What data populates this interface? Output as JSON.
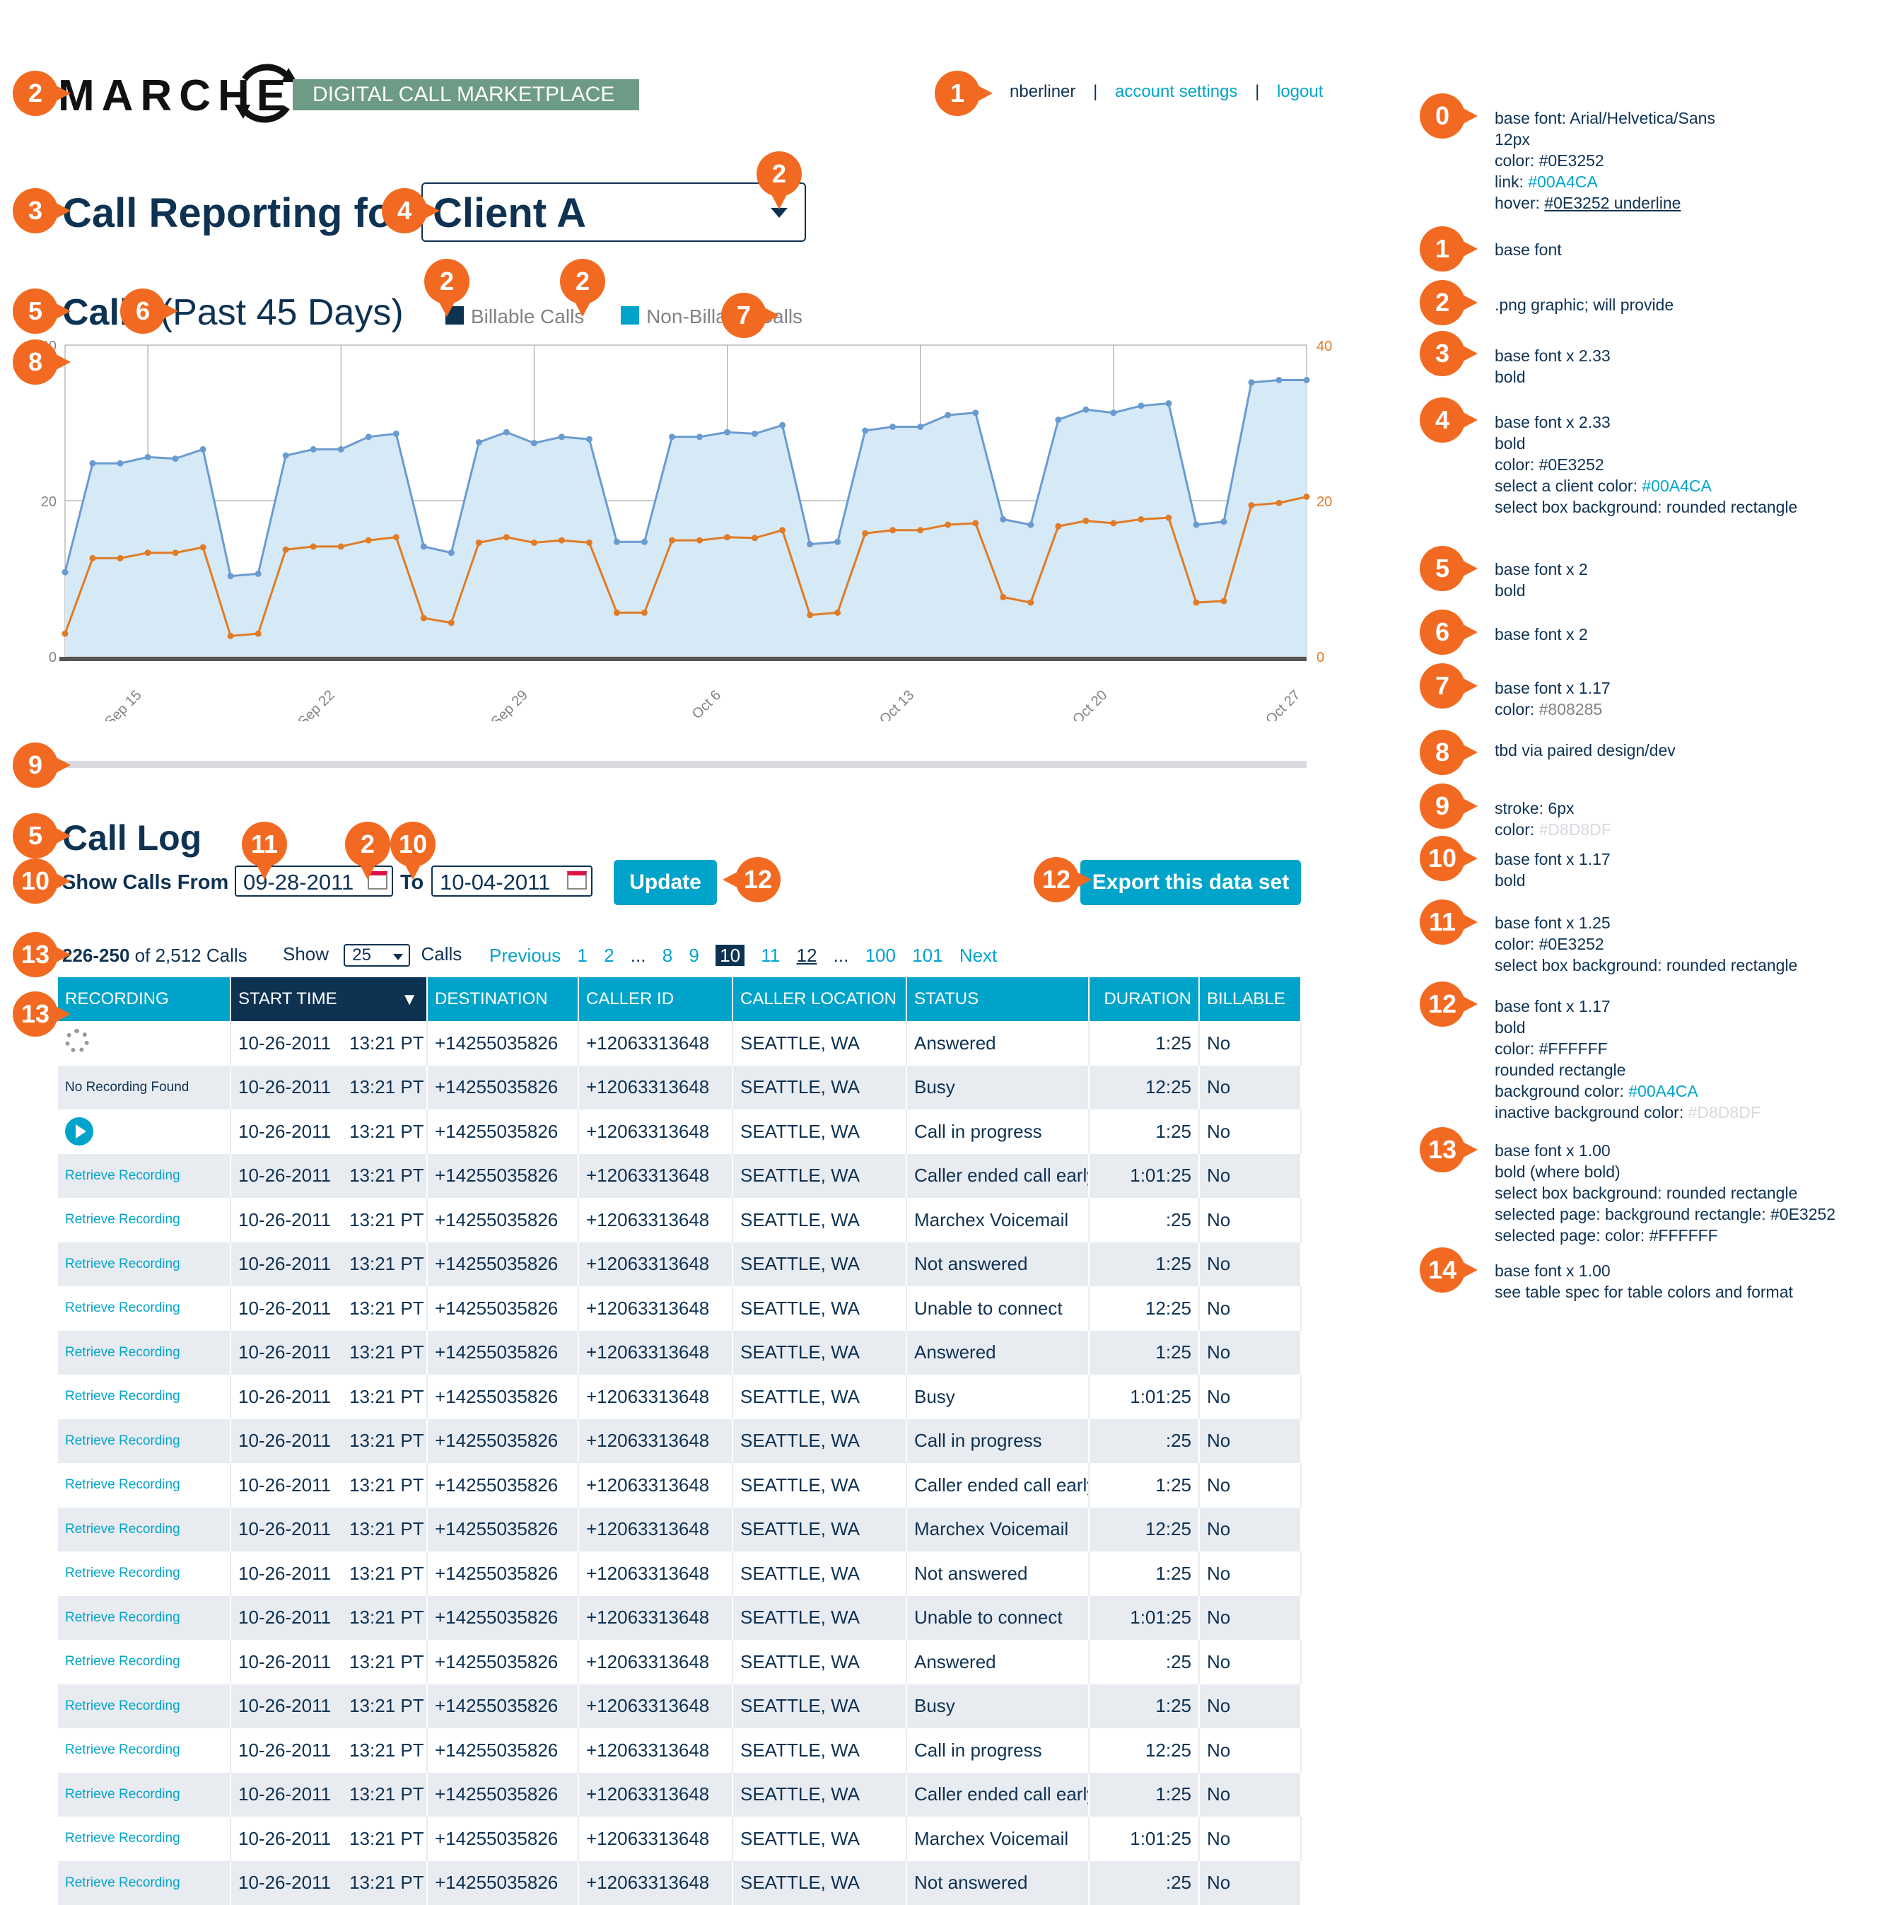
{
  "header": {
    "logo_text": "MARCHEX",
    "tagline": "DIGITAL CALL MARKETPLACE",
    "username": "nberliner",
    "separator": "|",
    "account_settings": "account settings",
    "logout": "logout"
  },
  "title": {
    "prefix": "Call Reporting for",
    "client": "Client A"
  },
  "calls_section": {
    "title_bold": "Calls",
    "title_light": "(Past 45 Days)",
    "legend_billable": "Billable Calls",
    "legend_nonbillable": "Non-Billable Calls"
  },
  "chart_data": {
    "type": "area",
    "title": "Calls (Past 45 Days)",
    "x_tick_labels": [
      "Sep 15",
      "Sep 22",
      "Sep 29",
      "Oct 6",
      "Oct 13",
      "Oct 20",
      "Oct 27"
    ],
    "y_left_ticks": [
      "0",
      "20",
      "40"
    ],
    "y_right_ticks": [
      "0",
      "20",
      "40"
    ],
    "ylim": [
      0,
      40
    ],
    "grid": true,
    "series": [
      {
        "name": "Non-Billable Calls",
        "color": "#6A9BD0",
        "fill": "#D6E9F7",
        "values": [
          10.8,
          24.8,
          24.8,
          25.6,
          25.4,
          26.6,
          10.3,
          10.6,
          25.8,
          26.6,
          26.6,
          28.2,
          28.6,
          14.1,
          13.3,
          27.5,
          28.8,
          27.4,
          28.2,
          27.9,
          14.7,
          14.7,
          28.2,
          28.2,
          28.8,
          28.6,
          29.7,
          14.4,
          14.7,
          29.0,
          29.5,
          29.5,
          31.0,
          31.3,
          17.6,
          16.9,
          30.4,
          31.7,
          31.3,
          32.2,
          32.5,
          16.9,
          17.3,
          35.2,
          35.5,
          35.5
        ]
      },
      {
        "name": "Billable Calls",
        "color": "#E07B26",
        "values": [
          2.9,
          12.6,
          12.6,
          13.3,
          13.3,
          14.0,
          2.6,
          2.9,
          13.7,
          14.1,
          14.1,
          14.9,
          15.3,
          4.9,
          4.3,
          14.6,
          15.3,
          14.6,
          14.9,
          14.6,
          5.6,
          5.6,
          14.9,
          14.9,
          15.3,
          15.2,
          16.2,
          5.3,
          5.6,
          15.8,
          16.2,
          16.2,
          16.9,
          17.1,
          7.6,
          6.9,
          16.7,
          17.4,
          17.1,
          17.6,
          17.8,
          6.9,
          7.1,
          19.4,
          19.7,
          20.5
        ]
      }
    ]
  },
  "call_log": {
    "title": "Call Log",
    "show_from_label": "Show Calls From",
    "from_date": "09-28-2011",
    "to_label": "To",
    "to_date": "10-04-2011",
    "update_button": "Update",
    "export_button": "Export this data set",
    "range_bold": "226-250",
    "range_rest": "of 2,512 Calls",
    "show_label": "Show",
    "show_value": "25",
    "calls_label": "Calls",
    "pager": {
      "previous": "Previous",
      "p1": "1",
      "p2": "2",
      "dots1": "...",
      "p8": "8",
      "p9": "9",
      "p10": "10",
      "p11": "11",
      "p12": "12",
      "dots2": "...",
      "p100": "100",
      "p101": "101",
      "next": "Next"
    },
    "columns": [
      "RECORDING",
      "START TIME",
      "DESTINATION",
      "CALLER ID",
      "CALLER LOCATION",
      "STATUS",
      "DURATION",
      "BILLABLE"
    ],
    "sort_indicator": "▼",
    "rows": [
      {
        "rec_type": "spinner",
        "recording": "",
        "date": "10-26-2011",
        "time": "13:21 PT",
        "destination": "+14255035826",
        "caller_id": "+12063313648",
        "location": "SEATTLE, WA",
        "status": "Answered",
        "duration": "1:25",
        "billable": "No"
      },
      {
        "rec_type": "text",
        "recording": "No Recording Found",
        "date": "10-26-2011",
        "time": "13:21 PT",
        "destination": "+14255035826",
        "caller_id": "+12063313648",
        "location": "SEATTLE, WA",
        "status": "Busy",
        "duration": "12:25",
        "billable": "No"
      },
      {
        "rec_type": "play",
        "recording": "",
        "date": "10-26-2011",
        "time": "13:21 PT",
        "destination": "+14255035826",
        "caller_id": "+12063313648",
        "location": "SEATTLE, WA",
        "status": "Call in progress",
        "duration": "1:25",
        "billable": "No"
      },
      {
        "rec_type": "link",
        "recording": "Retrieve Recording",
        "date": "10-26-2011",
        "time": "13:21 PT",
        "destination": "+14255035826",
        "caller_id": "+12063313648",
        "location": "SEATTLE, WA",
        "status": "Caller ended call early",
        "duration": "1:01:25",
        "billable": "No"
      },
      {
        "rec_type": "link",
        "recording": "Retrieve Recording",
        "date": "10-26-2011",
        "time": "13:21 PT",
        "destination": "+14255035826",
        "caller_id": "+12063313648",
        "location": "SEATTLE, WA",
        "status": "Marchex Voicemail",
        "duration": ":25",
        "billable": "No"
      },
      {
        "rec_type": "link",
        "recording": "Retrieve Recording",
        "date": "10-26-2011",
        "time": "13:21 PT",
        "destination": "+14255035826",
        "caller_id": "+12063313648",
        "location": "SEATTLE, WA",
        "status": "Not answered",
        "duration": "1:25",
        "billable": "No"
      },
      {
        "rec_type": "link",
        "recording": "Retrieve Recording",
        "date": "10-26-2011",
        "time": "13:21 PT",
        "destination": "+14255035826",
        "caller_id": "+12063313648",
        "location": "SEATTLE, WA",
        "status": "Unable to connect",
        "duration": "12:25",
        "billable": "No"
      },
      {
        "rec_type": "link",
        "recording": "Retrieve Recording",
        "date": "10-26-2011",
        "time": "13:21 PT",
        "destination": "+14255035826",
        "caller_id": "+12063313648",
        "location": "SEATTLE, WA",
        "status": "Answered",
        "duration": "1:25",
        "billable": "No"
      },
      {
        "rec_type": "link",
        "recording": "Retrieve Recording",
        "date": "10-26-2011",
        "time": "13:21 PT",
        "destination": "+14255035826",
        "caller_id": "+12063313648",
        "location": "SEATTLE, WA",
        "status": "Busy",
        "duration": "1:01:25",
        "billable": "No"
      },
      {
        "rec_type": "link",
        "recording": "Retrieve Recording",
        "date": "10-26-2011",
        "time": "13:21 PT",
        "destination": "+14255035826",
        "caller_id": "+12063313648",
        "location": "SEATTLE, WA",
        "status": "Call in progress",
        "duration": ":25",
        "billable": "No"
      },
      {
        "rec_type": "link",
        "recording": "Retrieve Recording",
        "date": "10-26-2011",
        "time": "13:21 PT",
        "destination": "+14255035826",
        "caller_id": "+12063313648",
        "location": "SEATTLE, WA",
        "status": "Caller ended call early",
        "duration": "1:25",
        "billable": "No"
      },
      {
        "rec_type": "link",
        "recording": "Retrieve Recording",
        "date": "10-26-2011",
        "time": "13:21 PT",
        "destination": "+14255035826",
        "caller_id": "+12063313648",
        "location": "SEATTLE, WA",
        "status": "Marchex Voicemail",
        "duration": "12:25",
        "billable": "No"
      },
      {
        "rec_type": "link",
        "recording": "Retrieve Recording",
        "date": "10-26-2011",
        "time": "13:21 PT",
        "destination": "+14255035826",
        "caller_id": "+12063313648",
        "location": "SEATTLE, WA",
        "status": "Not answered",
        "duration": "1:25",
        "billable": "No"
      },
      {
        "rec_type": "link",
        "recording": "Retrieve Recording",
        "date": "10-26-2011",
        "time": "13:21 PT",
        "destination": "+14255035826",
        "caller_id": "+12063313648",
        "location": "SEATTLE, WA",
        "status": "Unable to connect",
        "duration": "1:01:25",
        "billable": "No"
      },
      {
        "rec_type": "link",
        "recording": "Retrieve Recording",
        "date": "10-26-2011",
        "time": "13:21 PT",
        "destination": "+14255035826",
        "caller_id": "+12063313648",
        "location": "SEATTLE, WA",
        "status": "Answered",
        "duration": ":25",
        "billable": "No"
      },
      {
        "rec_type": "link",
        "recording": "Retrieve Recording",
        "date": "10-26-2011",
        "time": "13:21 PT",
        "destination": "+14255035826",
        "caller_id": "+12063313648",
        "location": "SEATTLE, WA",
        "status": "Busy",
        "duration": "1:25",
        "billable": "No"
      },
      {
        "rec_type": "link",
        "recording": "Retrieve Recording",
        "date": "10-26-2011",
        "time": "13:21 PT",
        "destination": "+14255035826",
        "caller_id": "+12063313648",
        "location": "SEATTLE, WA",
        "status": "Call in progress",
        "duration": "12:25",
        "billable": "No"
      },
      {
        "rec_type": "link",
        "recording": "Retrieve Recording",
        "date": "10-26-2011",
        "time": "13:21 PT",
        "destination": "+14255035826",
        "caller_id": "+12063313648",
        "location": "SEATTLE, WA",
        "status": "Caller ended call early",
        "duration": "1:25",
        "billable": "No"
      },
      {
        "rec_type": "link",
        "recording": "Retrieve Recording",
        "date": "10-26-2011",
        "time": "13:21 PT",
        "destination": "+14255035826",
        "caller_id": "+12063313648",
        "location": "SEATTLE, WA",
        "status": "Marchex Voicemail",
        "duration": "1:01:25",
        "billable": "No"
      },
      {
        "rec_type": "link",
        "recording": "Retrieve Recording",
        "date": "10-26-2011",
        "time": "13:21 PT",
        "destination": "+14255035826",
        "caller_id": "+12063313648",
        "location": "SEATTLE, WA",
        "status": "Not answered",
        "duration": ":25",
        "billable": "No"
      }
    ]
  },
  "markers": {
    "m0": "0",
    "m1": "1",
    "m2": "2",
    "m3": "3",
    "m4": "4",
    "m5": "5",
    "m6": "6",
    "m7": "7",
    "m8": "8",
    "m9": "9",
    "m10": "10",
    "m11": "11",
    "m12": "12",
    "m13": "13",
    "m14": "14"
  },
  "spec": {
    "s0": {
      "l1": "base font: Arial/Helvetica/Sans",
      "l2": "12px",
      "l3": "color: #0E3252",
      "l4a": "link: ",
      "l4b": "#00A4CA",
      "l5a": "hover: ",
      "l5b": "#0E3252 underline"
    },
    "s1": {
      "l1": "base font"
    },
    "s2": {
      "l1": ".png graphic; will provide"
    },
    "s3": {
      "l1": "base font x 2.33",
      "l2": "bold"
    },
    "s4": {
      "l1": "base font x 2.33",
      "l2": "bold",
      "l3": "color: #0E3252",
      "l4a": "select a client color: ",
      "l4b": "#00A4CA",
      "l5": "select box background: rounded rectangle"
    },
    "s5": {
      "l1": "base font x 2",
      "l2": "bold"
    },
    "s6": {
      "l1": "base font x 2"
    },
    "s7": {
      "l1": "base font x 1.17",
      "l2a": "color: ",
      "l2b": "#808285"
    },
    "s8": {
      "l1": "tbd via paired design/dev"
    },
    "s9": {
      "l1": "stroke: 6px",
      "l2a": "color: ",
      "l2b": "#D8D8DF"
    },
    "s10": {
      "l1": "base font x 1.17",
      "l2": "bold"
    },
    "s11": {
      "l1": "base font x 1.25",
      "l2": "color: #0E3252",
      "l3": "select box background: rounded rectangle"
    },
    "s12": {
      "l1": "base font x 1.17",
      "l2": "bold",
      "l3": "color: #FFFFFF",
      "l4": "rounded rectangle",
      "l5a": "background color: ",
      "l5b": "#00A4CA",
      "l6a": "inactive background color: ",
      "l6b": "#D8D8DF"
    },
    "s13": {
      "l1": "base font x 1.00",
      "l2": "bold (where bold)",
      "l3": "select box background: rounded rectangle",
      "l4": "selected page: background rectangle: #0E3252",
      "l5": "selected page: color: #FFFFFF"
    },
    "s14": {
      "l1": "base font x 1.00",
      "l2": "see table spec for table colors and format"
    }
  }
}
